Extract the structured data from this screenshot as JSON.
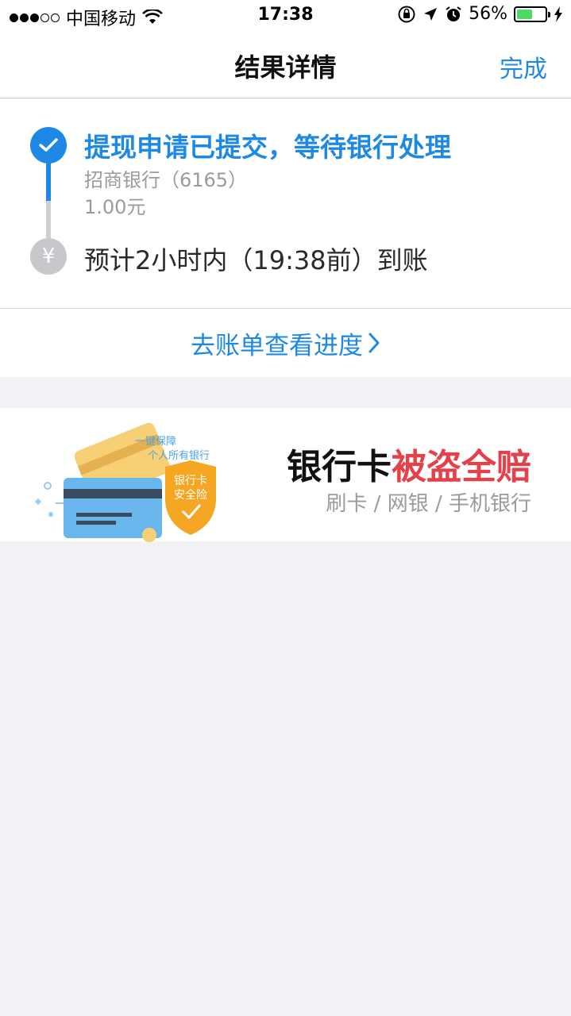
{
  "status_bar": {
    "carrier": "中国移动",
    "time": "17:38",
    "battery": "56%",
    "battery_level": 0.56
  },
  "nav": {
    "title": "结果详情",
    "done": "完成"
  },
  "progress": {
    "step1_title": "提现申请已提交，等待银行处理",
    "step1_bank": "招商银行（6165）",
    "step1_amount": "1.00元",
    "step2_text": "预计2小时内（19:38前）到账",
    "yen_symbol": "¥"
  },
  "link": {
    "label": "去账单查看进度"
  },
  "banner": {
    "art_line1": "一键保障",
    "art_line2": "个人所有银行",
    "badge_line1": "银行卡",
    "badge_line2": "安全险",
    "headline_black": "银行卡",
    "headline_red": "被盗全赔",
    "subtitle": "刷卡 / 网银 / 手机银行"
  },
  "colors": {
    "accent": "#1e88e5",
    "red": "#e5414b",
    "background": "#f2f2f6"
  }
}
